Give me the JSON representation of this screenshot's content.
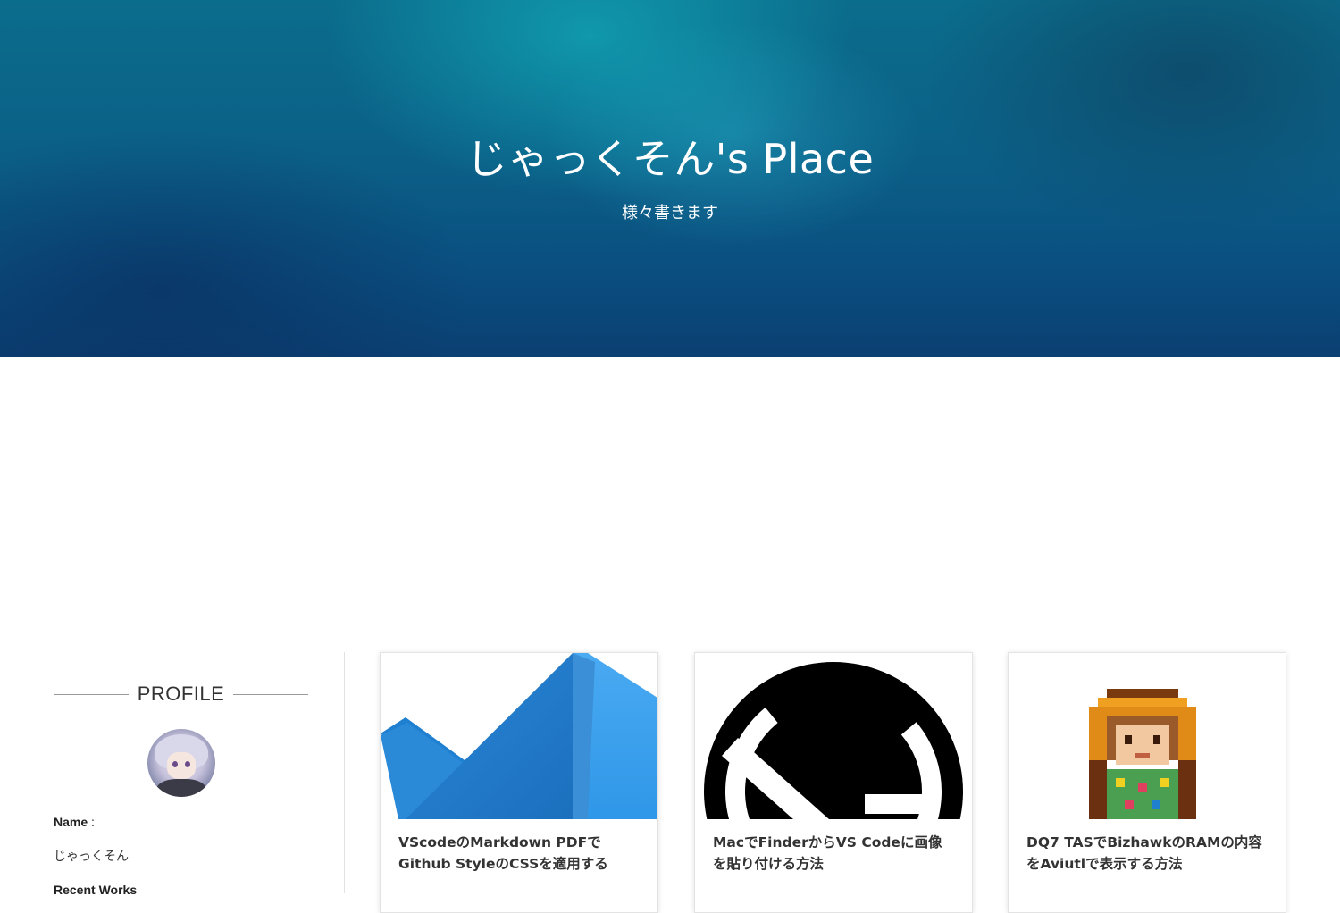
{
  "hero": {
    "title": "じゃっくそん's Place",
    "subtitle": "様々書きます"
  },
  "sidebar": {
    "heading": "PROFILE",
    "name_label": "Name",
    "name_colon": " :",
    "name_value": "じゃっくそん",
    "next_label": "Recent Works"
  },
  "cards": [
    {
      "title": "VScodeのMarkdown PDFでGithub StyleのCSSを適用する",
      "icon": "vscode-logo-icon"
    },
    {
      "title": "MacでFinderからVS Codeに画像を貼り付ける方法",
      "icon": "gatsby-logo-icon"
    },
    {
      "title": "DQ7 TASでBizhawkのRAMの内容をAviutlで表示する方法",
      "icon": "pixel-character-icon"
    }
  ],
  "colors": {
    "hero_dark": "#0b3f72",
    "hero_light": "#14bec8",
    "vscode_blue_dark": "#1f7fd1",
    "vscode_blue_light": "#3ea6f0"
  }
}
